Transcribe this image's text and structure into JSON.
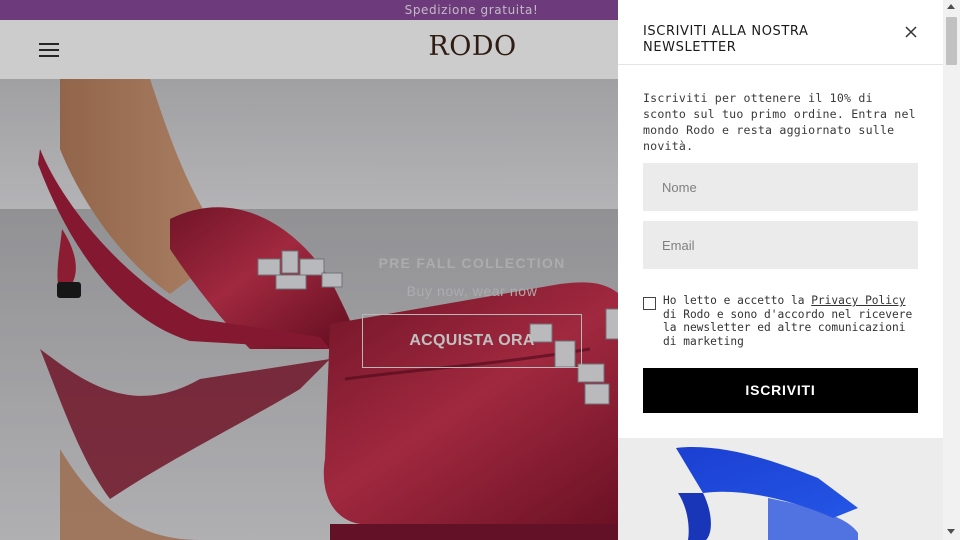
{
  "promo": {
    "text": "Spedizione gratuita!"
  },
  "header": {
    "logo": "RODO",
    "menu_icon": "hamburger-menu-icon"
  },
  "hero": {
    "kicker": "PRE FALL COLLECTION",
    "subtitle": "Buy now, wear now",
    "cta_label": "ACQUISTA ORA"
  },
  "newsletter": {
    "title": "ISCRIVITI ALLA NOSTRA NEWSLETTER",
    "close_icon": "close-icon",
    "description": "Iscriviti per ottenere il 10% di sconto sul tuo primo ordine. Entra nel mondo Rodo e resta aggiornato sulle novità.",
    "name_placeholder": "Nome",
    "email_placeholder": "Email",
    "consent_prefix": "Ho letto e accetto la ",
    "consent_link": "Privacy Policy",
    "consent_suffix": " di Rodo e sono d'accordo nel ricevere la newsletter ed altre comunicazioni di marketing",
    "submit_label": "ISCRIVITI"
  },
  "colors": {
    "promo_bg": "#89499a",
    "button_bg": "#000000",
    "field_bg": "#ebebeb"
  }
}
